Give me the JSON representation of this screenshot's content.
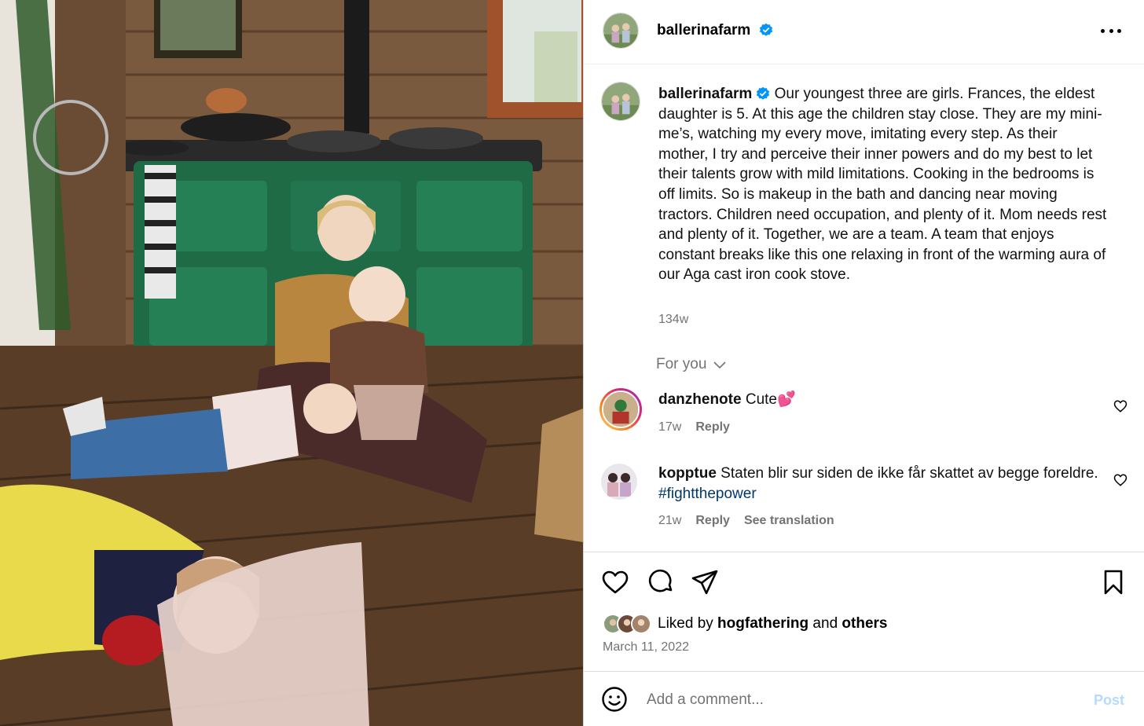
{
  "colors": {
    "link": "#00376b",
    "muted": "#737373",
    "verified": "#0095f6",
    "post_disabled": "#b3dbff",
    "story_ring_start": "#feda75",
    "story_ring_end": "#d62976"
  },
  "post": {
    "username": "ballerinafarm",
    "verified_icon": "verified-badge-icon",
    "more_icon": "more-options-icon",
    "caption": "Our youngest three are girls. Frances, the eldest daughter is 5. At this age the children stay close. They are my mini-me’s, watching my every move, imitating every step. As their mother, I try and perceive their inner powers and do my best to let their talents grow with mild limitations. Cooking in the bedrooms is off limits. So is makeup in the bath and dancing near moving tractors. Children need occupation, and plenty of it. Mom needs rest and plenty of it. Together, we are a team. A team that enjoys constant breaks like this one relaxing in front of the warming aura of our Aga cast iron cook stove.",
    "time": "134w"
  },
  "comments_filter": {
    "label": "For you",
    "icon": "chevron-down-icon"
  },
  "comments": [
    {
      "username": "danzhenote",
      "text": "Cute💕",
      "tag": "",
      "time": "17w",
      "reply": "Reply",
      "translate": ""
    },
    {
      "username": "kopptue",
      "text": "Staten blir sur siden de ikke får skattet av begge foreldre. ",
      "tag": "#fightthepower",
      "time": "21w",
      "reply": "Reply",
      "translate": "See translation"
    }
  ],
  "actions": {
    "like_icon": "heart-icon",
    "comment_icon": "comment-icon",
    "share_icon": "share-icon",
    "save_icon": "bookmark-icon"
  },
  "likes": {
    "prefix": "Liked by ",
    "user": "hogfathering",
    "middle": " and ",
    "others": "others"
  },
  "date": "March 11, 2022",
  "add_comment": {
    "placeholder": "Add a comment...",
    "post_label": "Post",
    "emoji_icon": "emoji-icon"
  }
}
